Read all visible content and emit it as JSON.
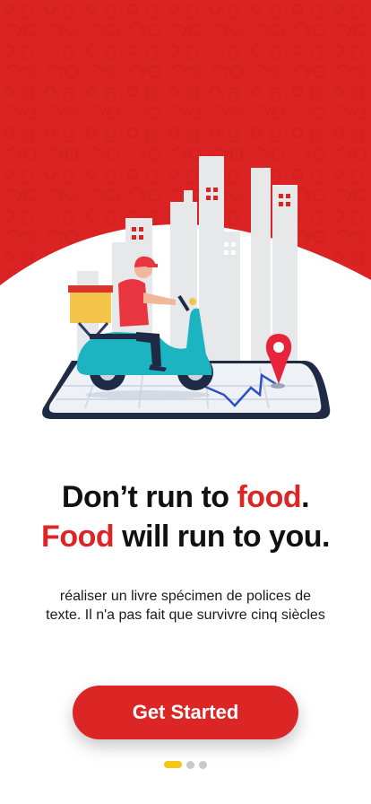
{
  "colors": {
    "brand_red": "#dc2626",
    "text_dark": "#111111",
    "dot_active": "#f5c518",
    "dot_inactive": "#c8c8c8"
  },
  "headline": {
    "line1_part1": "Don’t run to ",
    "line1_accent": "food",
    "line1_end": ".",
    "line2_accent": "Food",
    "line2_rest": " will run to you."
  },
  "subtitle": "réaliser un livre spécimen de polices de texte. Il n'a pas fait que survivre cinq siècles",
  "cta": {
    "label": "Get Started"
  },
  "pagination": {
    "total": 3,
    "active_index": 0
  },
  "icons": [
    "food-pattern-background",
    "delivery-scooter-illustration",
    "map-pin-icon"
  ]
}
